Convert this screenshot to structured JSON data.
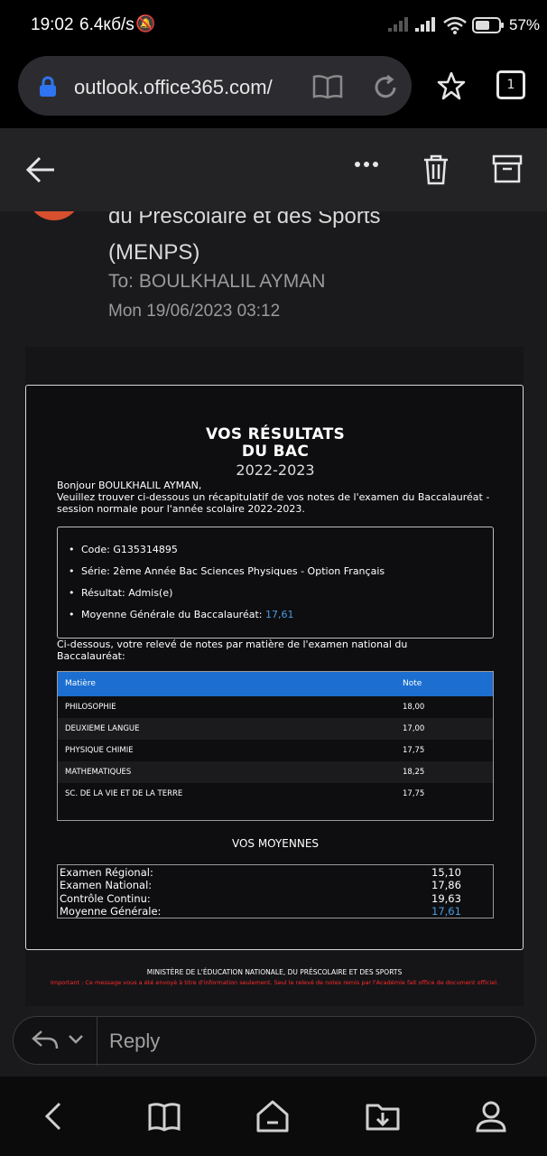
{
  "status": {
    "time": "19:02",
    "speed": "6.4кб/s",
    "battery": "57%"
  },
  "browser": {
    "url": "outlook.office365.com/",
    "tab_count": "1"
  },
  "email": {
    "sender_line1": "du Préscolaire et des Sports",
    "sender_line2": "(MENPS)",
    "to": "To: BOULKHALIL AYMAN",
    "date": "Mon 19/06/2023 03:12",
    "heading_line1": "VOS RÉSULTATS",
    "heading_line2": "DU BAC",
    "year": "2022-2023",
    "greeting": "Bonjour BOULKHALIL AYMAN,",
    "intro": "Veuillez trouver ci-dessous un récapitulatif de vos notes de l'examen du Baccalauréat - session normale pour l'année scolaire 2022-2023.",
    "info": {
      "code": "Code: G135314895",
      "serie": "Série: 2ème Année Bac Sciences Physiques - Option Français",
      "resultat": "Résultat: Admis(e)",
      "moyenne_label": "Moyenne Générale du Baccalauréat: ",
      "moyenne_value": "17,61"
    },
    "table_intro": "Ci-dessous, votre relevé de notes par matière de l'examen national du Baccalauréat:",
    "table": {
      "headers": [
        "Matière",
        "Note"
      ],
      "rows": [
        {
          "subject": "PHILOSOPHIE",
          "note": "18,00"
        },
        {
          "subject": "DEUXIEME LANGUE",
          "note": "17,00"
        },
        {
          "subject": "PHYSIQUE CHIMIE",
          "note": "17,75"
        },
        {
          "subject": "MATHEMATIQUES",
          "note": "18,25"
        },
        {
          "subject": "SC. DE LA VIE ET DE LA TERRE",
          "note": "17,75"
        }
      ]
    },
    "moyennes_title": "VOS MOYENNES",
    "moyennes": [
      {
        "label": "Examen Régional:",
        "value": "15,10"
      },
      {
        "label": "Examen National:",
        "value": "17,86"
      },
      {
        "label": "Contrôle Continu:",
        "value": "19,63"
      },
      {
        "label": "Moyenne Générale:",
        "value": "17,61"
      }
    ],
    "footer_org": "MINISTÈRE DE L'ÉDUCATION NATIONALE, DU PRÉSCOLAIRE ET DES SPORTS",
    "footer_note": "Important : Ce message vous a été envoyé à titre d'information seulement. Seul le relevé de notes remis par l'Académie fait office de document officiel."
  },
  "reply": {
    "placeholder": "Reply"
  },
  "colors": {
    "accent_blue": "#1c6fd0",
    "link_blue": "#4a9be0",
    "warning_red": "#ff2a2a",
    "avatar": "#d6502f"
  }
}
